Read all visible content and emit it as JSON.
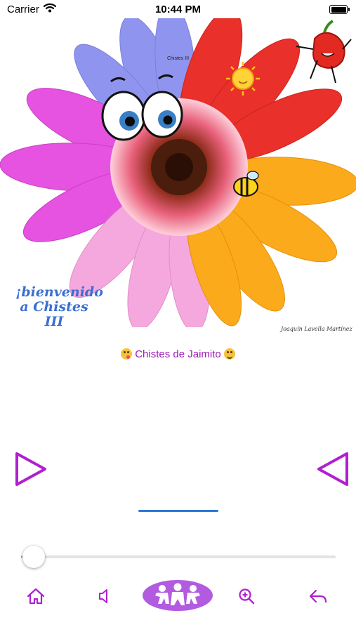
{
  "status_bar": {
    "carrier": "Carrier",
    "time": "10:44 PM"
  },
  "artwork": {
    "small_caption": "Chistes III",
    "welcome_lines": [
      "¡bienvenido",
      "a Chistes",
      "III"
    ],
    "signature": "Joaquín Lavella Martínez"
  },
  "content": {
    "title": "Chistes de Jaimito"
  },
  "player": {
    "position_fraction": 0.035
  },
  "colors": {
    "accent": "#b01fd0",
    "title": "#9b1bb5",
    "progress": "#2b78d8"
  },
  "icons": {
    "play_left": "play-triangle-right-icon",
    "play_right": "play-triangle-left-icon",
    "home": "home-icon",
    "volume": "speaker-icon",
    "center": "children-group-icon",
    "zoom": "zoom-in-icon",
    "back": "reply-arrow-icon"
  }
}
